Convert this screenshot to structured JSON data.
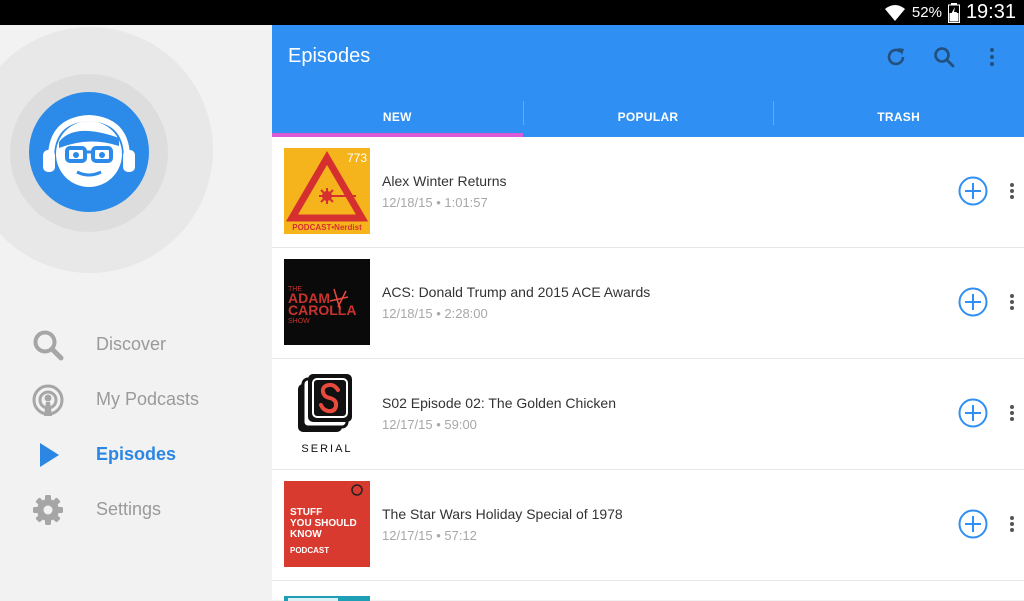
{
  "status_bar": {
    "battery_percent": "52%",
    "time": "19:31"
  },
  "sidebar": {
    "items": [
      {
        "label": "Discover",
        "icon": "search-icon",
        "active": false
      },
      {
        "label": "My Podcasts",
        "icon": "podcast-icon",
        "active": false
      },
      {
        "label": "Episodes",
        "icon": "play-icon",
        "active": true
      },
      {
        "label": "Settings",
        "icon": "gear-icon",
        "active": false
      }
    ]
  },
  "appbar": {
    "title": "Episodes",
    "actions": [
      "refresh-icon",
      "search-icon",
      "more-vert-icon"
    ]
  },
  "tabs": [
    {
      "label": "NEW",
      "active": true
    },
    {
      "label": "POPULAR",
      "active": false
    },
    {
      "label": "TRASH",
      "active": false
    }
  ],
  "episodes": [
    {
      "title": "Alex Winter Returns",
      "meta": "12/18/15 • 1:01:57",
      "art": {
        "badge": "773",
        "caption": "PODCAST•Nerdist"
      }
    },
    {
      "title": "ACS: Donald Trump and 2015 ACE Awards",
      "meta": "12/18/15 • 2:28:00",
      "art": {
        "line1": "THE",
        "line2": "ADAM",
        "line3": "CAROLLA",
        "line4": "SHOW"
      }
    },
    {
      "title": "S02 Episode 02: The Golden Chicken",
      "meta": "12/17/15 • 59:00",
      "art": {
        "caption": "SERIAL"
      }
    },
    {
      "title": "The Star Wars Holiday Special of 1978",
      "meta": "12/17/15 • 57:12",
      "art": {
        "line1": "STUFF",
        "line2": "YOU SHOULD",
        "line3": "KNOW",
        "line4": "PODCAST"
      }
    }
  ],
  "colors": {
    "primary": "#2f8ff2",
    "tab_indicator": "#d95bd6",
    "active_nav": "#2b87e3",
    "avatar": "#2c8ae8"
  }
}
